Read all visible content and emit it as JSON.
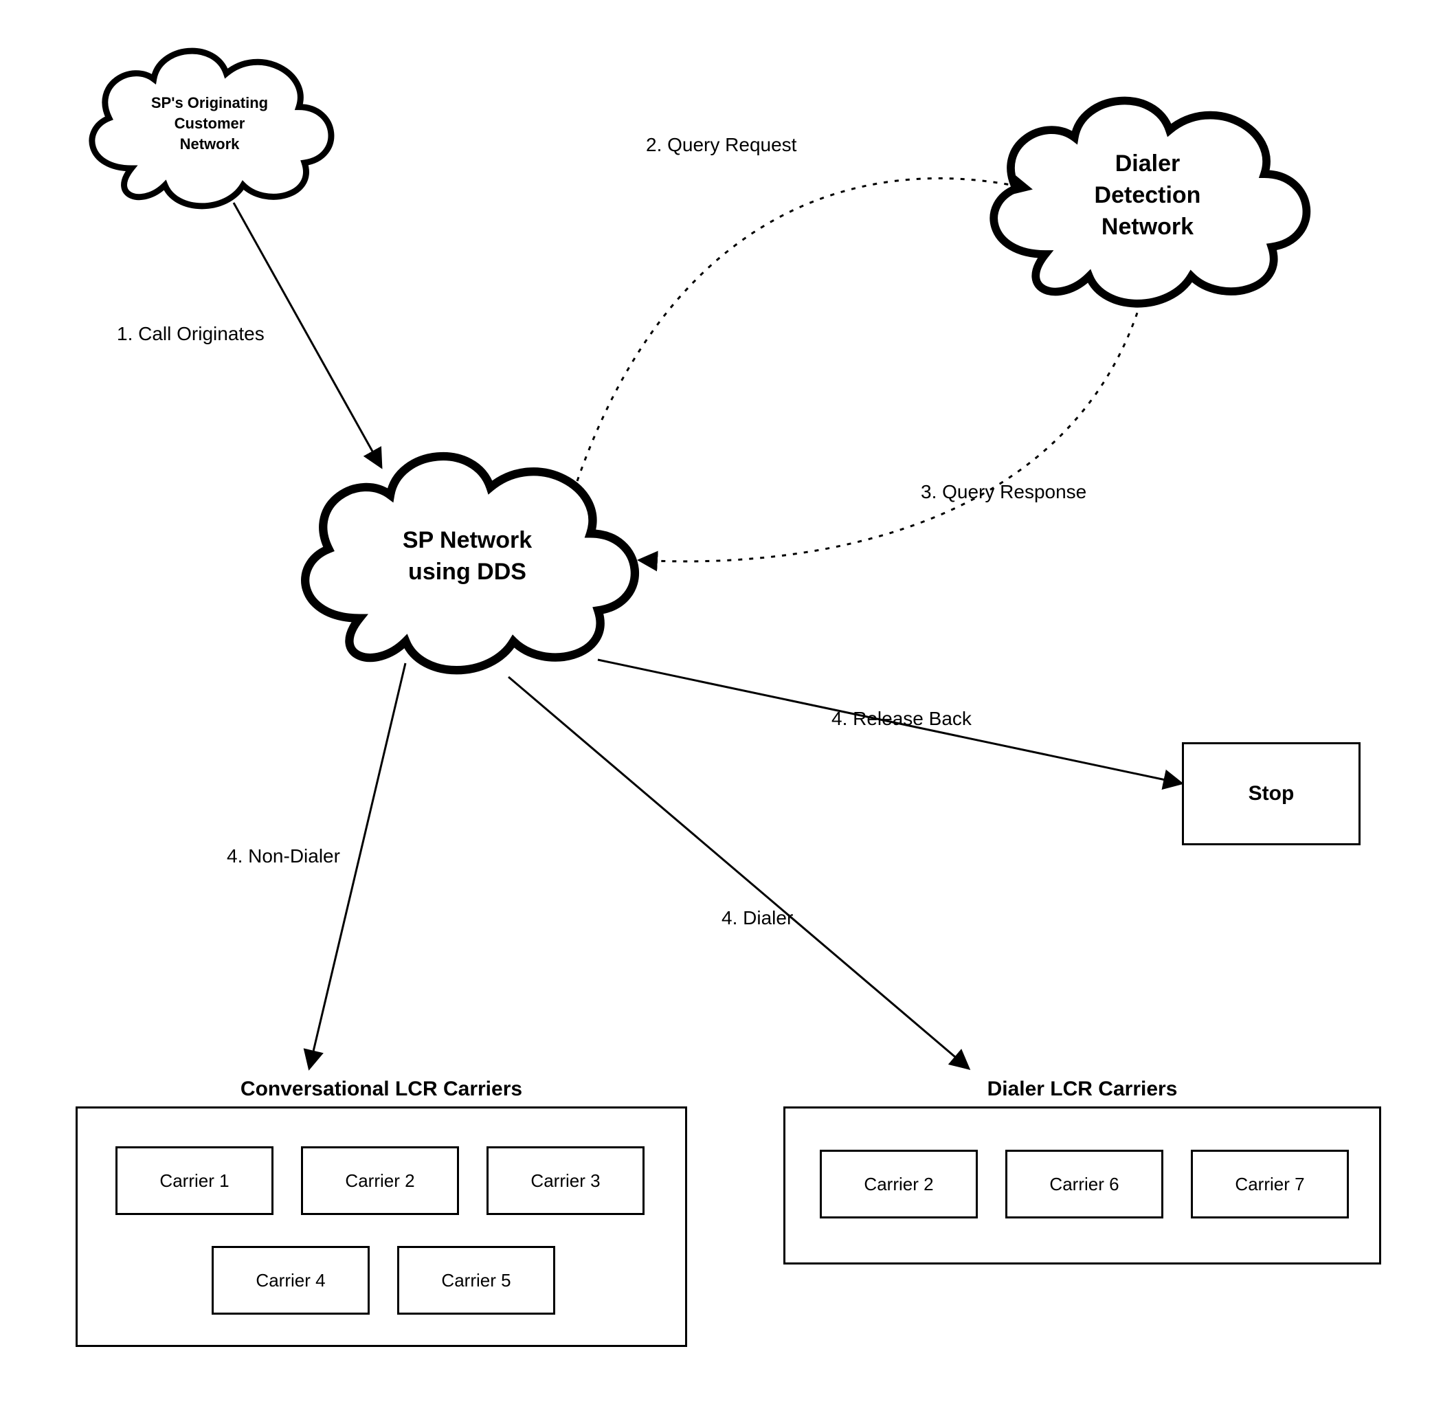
{
  "clouds": {
    "customer": {
      "line1": "SP's Originating",
      "line2": "Customer",
      "line3": "Network"
    },
    "dialer_detection": {
      "line1": "Dialer",
      "line2": "Detection",
      "line3": "Network"
    },
    "sp_network": {
      "line1": "SP Network",
      "line2": "using DDS"
    }
  },
  "labels": {
    "step1": "1.  Call Originates",
    "step2": "2.  Query Request",
    "step3": "3.  Query Response",
    "step4_nondialer": "4.  Non-Dialer",
    "step4_dialer": "4.  Dialer",
    "step4_release": "4.  Release Back"
  },
  "stop_label": "Stop",
  "groups": {
    "conversational": {
      "title": "Conversational LCR Carriers",
      "carriers": [
        "Carrier 1",
        "Carrier 2",
        "Carrier 3",
        "Carrier 4",
        "Carrier 5"
      ]
    },
    "dialer": {
      "title": "Dialer LCR Carriers",
      "carriers": [
        "Carrier 2",
        "Carrier 6",
        "Carrier 7"
      ]
    }
  },
  "colors": {
    "stroke": "#000000",
    "bg": "#ffffff"
  }
}
